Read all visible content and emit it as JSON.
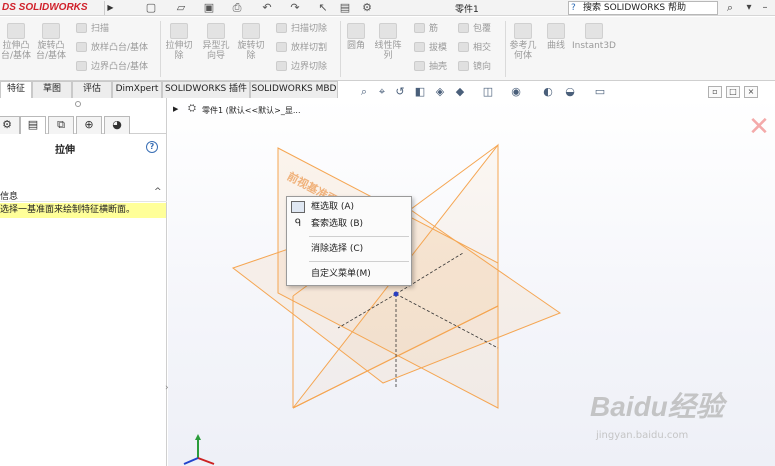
{
  "app": {
    "logo_text": "DS SOLIDWORKS",
    "document_title": "零件1",
    "help_search_placeholder": "搜索 SOLIDWORKS 帮助",
    "colors": {
      "logo_red": "#d0202a",
      "plane_orange": "#f5a653",
      "info_yellow": "#ffff99"
    }
  },
  "command_manager": {
    "extrude_boss": "拉伸凸\n台/基体",
    "revolve_boss": "旋转凸\n台/基体",
    "sweep": "扫描",
    "loft_boss": "放样凸台/基体",
    "boundary_boss": "边界凸台/基体",
    "extrude_cut": "拉伸切\n除",
    "hole_wizard": "异型孔\n向导",
    "revolve_cut": "旋转切\n除",
    "swept_cut": "扫描切除",
    "lofted_cut": "放样切割",
    "boundary_cut": "边界切除",
    "fillet": "圆角",
    "linear_pattern": "线性阵\n列",
    "rib": "筋",
    "draft": "拔模",
    "shell": "抽壳",
    "wrap": "包覆",
    "intersect": "相交",
    "mirror": "镜向",
    "reference_geometry": "参考几\n何体",
    "curves": "曲线",
    "instant3d": "Instant3D"
  },
  "tabs": [
    {
      "label": "特征"
    },
    {
      "label": "草图"
    },
    {
      "label": "评估"
    },
    {
      "label": "DimXpert"
    },
    {
      "label": "SOLIDWORKS 插件"
    },
    {
      "label": "SOLIDWORKS MBD"
    }
  ],
  "property_manager": {
    "title": "拉伸",
    "help": "?",
    "info_header": "信息",
    "info_message": "选择一基准面来绘制特征横断面。"
  },
  "feature_tree": {
    "part_name": "零件1",
    "config_text": "(默认<<默认>_显..."
  },
  "graphics": {
    "front_plane_label": "前视基准面"
  },
  "context_menu": {
    "items": [
      {
        "label": "框选取 (A)"
      },
      {
        "label": "套索选取 (B)"
      },
      {
        "label": "消除选择 (C)"
      },
      {
        "label": "自定义菜单(M)"
      }
    ]
  },
  "watermark": {
    "brand": "Baidu经验",
    "url": "jingyan.baidu.com"
  }
}
